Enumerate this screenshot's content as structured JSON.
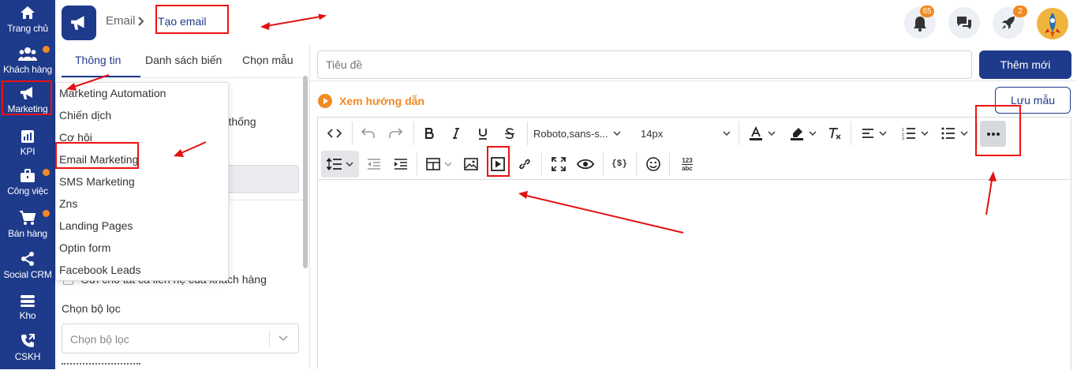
{
  "nav": {
    "items": [
      {
        "label": "Trang chủ",
        "icon": "home-icon"
      },
      {
        "label": "Khách hàng",
        "icon": "users-icon"
      },
      {
        "label": "Marketing",
        "icon": "megaphone-icon"
      },
      {
        "label": "KPI",
        "icon": "chart-icon"
      },
      {
        "label": "Công việc",
        "icon": "briefcase-icon"
      },
      {
        "label": "Bán hàng",
        "icon": "cart-icon"
      },
      {
        "label": "Social CRM",
        "icon": "share-icon"
      },
      {
        "label": "Kho",
        "icon": "warehouse-icon"
      },
      {
        "label": "CSKH",
        "icon": "phone-icon"
      }
    ]
  },
  "header": {
    "breadcrumb_parent": "Email",
    "breadcrumb_current": "Tạo email",
    "notifications_count": "65",
    "rocket_count": "2"
  },
  "tabs": [
    "Thông tin",
    "Danh sách biến",
    "Chọn mẫu"
  ],
  "left_panel": {
    "partial_text": "hệ thống",
    "checkbox_label": "Gửi cho tất cả liên hệ của khách hàng",
    "filter_label": "Chọn bộ lọc",
    "filter_placeholder": "Chọn bộ lọc"
  },
  "dropdown": {
    "items": [
      "Marketing Automation",
      "Chiến dịch",
      "Cơ hội",
      "Email Marketing",
      "SMS Marketing",
      "Zns",
      "Landing Pages",
      "Optin form",
      "Facebook Leads"
    ]
  },
  "editor": {
    "title_placeholder": "Tiêu đề",
    "add_button": "Thêm mới",
    "guide_link": "Xem hướng dẫn",
    "save_template_button": "Lưu mẫu",
    "font_family": "Roboto,sans-s...",
    "font_size": "14px",
    "variables_label": "{$}",
    "counter_label_top": "123",
    "counter_label_bottom": "abc"
  },
  "colors": {
    "nav_bg": "#1e3a8a",
    "accent_orange": "#f08a24",
    "annotation_red": "#e11111"
  }
}
